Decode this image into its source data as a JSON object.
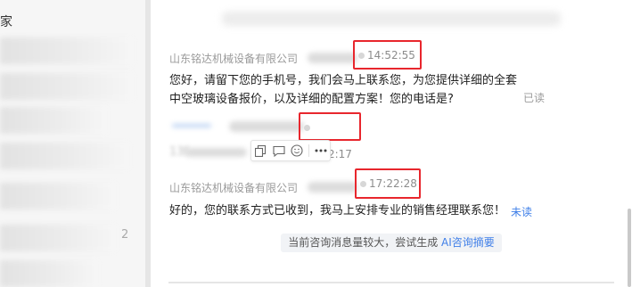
{
  "sidebar": {
    "partial_char": "家",
    "partial_char2": "2"
  },
  "messages": [
    {
      "sender": "山东铭达机械设备有限公司",
      "time": "14:52:55",
      "text_line1": "您好，请留下您的手机号，我们会马上联系您，为您提供详细的全套",
      "text_line2": "中空玻璃设备报价，以及详细的配置方案！您的电话是?",
      "status": "已读"
    },
    {
      "sender": "",
      "time": "17:22:17",
      "text": "13f"
    },
    {
      "sender": "山东铭达机械设备有限公司",
      "time": "17:22:28",
      "text": "好的，您的联系方式已收到，我马上安排专业的销售经理联系您！",
      "status": "未读"
    }
  ],
  "toolbar": {
    "icons": [
      "copy-icon",
      "comment-icon",
      "emoji-icon",
      "more-icon"
    ]
  },
  "notice": {
    "text": "当前咨询消息量较大，尝试生成 ",
    "link": "AI咨询摘要"
  },
  "colors": {
    "highlight_border": "#e8262d",
    "link_blue": "#3f7fe8",
    "sidebar_bg": "#f6f6f6"
  }
}
